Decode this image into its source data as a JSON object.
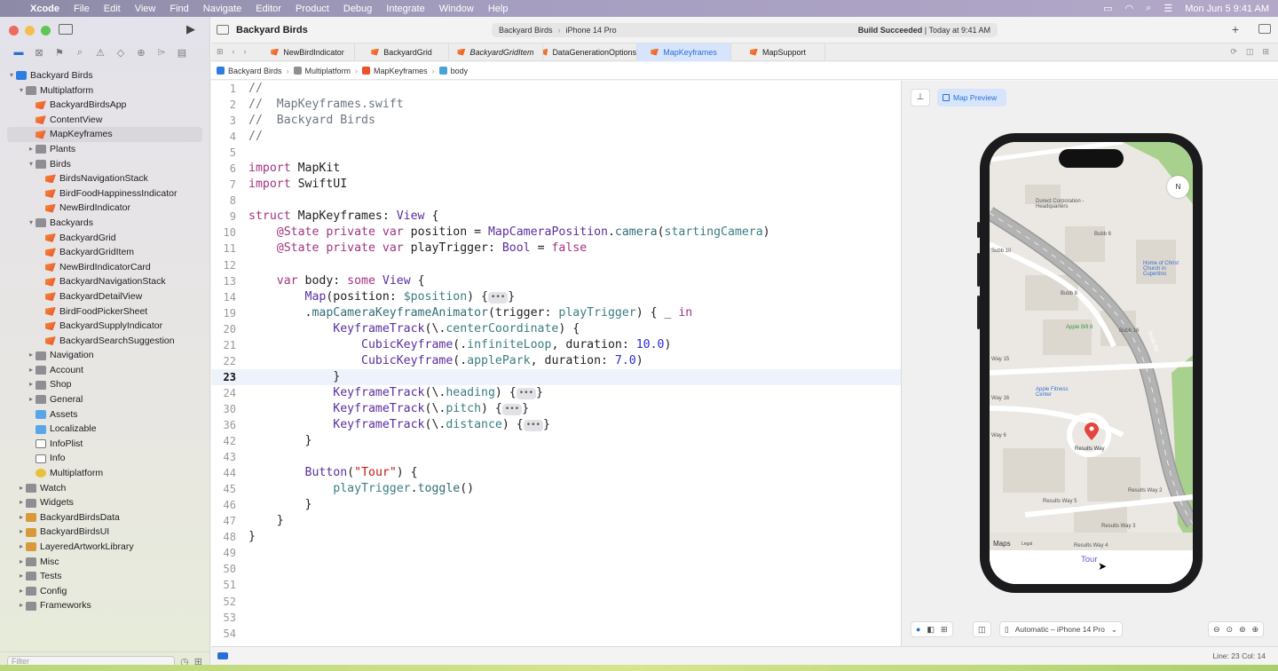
{
  "menubar": {
    "items": [
      "Xcode",
      "File",
      "Edit",
      "View",
      "Find",
      "Navigate",
      "Editor",
      "Product",
      "Debug",
      "Integrate",
      "Window",
      "Help"
    ],
    "clock": "Mon Jun 5  9:41 AM"
  },
  "toolbar": {
    "project": "Backyard Birds",
    "scheme": "Backyard Birds",
    "destination": "iPhone 14 Pro",
    "status_strong": "Build Succeeded",
    "status_time": "Today at 9:41 AM"
  },
  "tabs": [
    {
      "label": "NewBirdIndicator"
    },
    {
      "label": "BackyardGrid"
    },
    {
      "label": "BackyardGridItem"
    },
    {
      "label": "DataGenerationOptions"
    },
    {
      "label": "MapKeyframes"
    },
    {
      "label": "MapSupport"
    }
  ],
  "jumpbar": [
    "Backyard Birds",
    "Multiplatform",
    "MapKeyframes",
    "body"
  ],
  "navigator": {
    "filter_placeholder": "Filter",
    "items": [
      {
        "label": "Backyard Birds",
        "depth": 0,
        "chev": "▾",
        "icon": "proj"
      },
      {
        "label": "Multiplatform",
        "depth": 1,
        "chev": "▾",
        "icon": "folder"
      },
      {
        "label": "BackyardBirdsApp",
        "depth": 2,
        "chev": "",
        "icon": "swift"
      },
      {
        "label": "ContentView",
        "depth": 2,
        "chev": "",
        "icon": "swift"
      },
      {
        "label": "MapKeyframes",
        "depth": 2,
        "chev": "",
        "icon": "swift",
        "selected": true
      },
      {
        "label": "Plants",
        "depth": 2,
        "chev": "▸",
        "icon": "folder"
      },
      {
        "label": "Birds",
        "depth": 2,
        "chev": "▾",
        "icon": "folder"
      },
      {
        "label": "BirdsNavigationStack",
        "depth": 3,
        "chev": "",
        "icon": "swift"
      },
      {
        "label": "BirdFoodHappinessIndicator",
        "depth": 3,
        "chev": "",
        "icon": "swift"
      },
      {
        "label": "NewBirdIndicator",
        "depth": 3,
        "chev": "",
        "icon": "swift"
      },
      {
        "label": "Backyards",
        "depth": 2,
        "chev": "▾",
        "icon": "folder"
      },
      {
        "label": "BackyardGrid",
        "depth": 3,
        "chev": "",
        "icon": "swift"
      },
      {
        "label": "BackyardGridItem",
        "depth": 3,
        "chev": "",
        "icon": "swift"
      },
      {
        "label": "NewBirdIndicatorCard",
        "depth": 3,
        "chev": "",
        "icon": "swift"
      },
      {
        "label": "BackyardNavigationStack",
        "depth": 3,
        "chev": "",
        "icon": "swift"
      },
      {
        "label": "BackyardDetailView",
        "depth": 3,
        "chev": "",
        "icon": "swift"
      },
      {
        "label": "BirdFoodPickerSheet",
        "depth": 3,
        "chev": "",
        "icon": "swift"
      },
      {
        "label": "BackyardSupplyIndicator",
        "depth": 3,
        "chev": "",
        "icon": "swift"
      },
      {
        "label": "BackyardSearchSuggestion",
        "depth": 3,
        "chev": "",
        "icon": "swift"
      },
      {
        "label": "Navigation",
        "depth": 2,
        "chev": "▸",
        "icon": "folder"
      },
      {
        "label": "Account",
        "depth": 2,
        "chev": "▸",
        "icon": "folder"
      },
      {
        "label": "Shop",
        "depth": 2,
        "chev": "▸",
        "icon": "folder"
      },
      {
        "label": "General",
        "depth": 2,
        "chev": "▸",
        "icon": "folder"
      },
      {
        "label": "Assets",
        "depth": 2,
        "chev": "",
        "icon": "asset"
      },
      {
        "label": "Localizable",
        "depth": 2,
        "chev": "",
        "icon": "asset"
      },
      {
        "label": "InfoPlist",
        "depth": 2,
        "chev": "",
        "icon": "plist"
      },
      {
        "label": "Info",
        "depth": 2,
        "chev": "",
        "icon": "info"
      },
      {
        "label": "Multiplatform",
        "depth": 2,
        "chev": "",
        "icon": "ent"
      },
      {
        "label": "Watch",
        "depth": 1,
        "chev": "▸",
        "icon": "folder"
      },
      {
        "label": "Widgets",
        "depth": 1,
        "chev": "▸",
        "icon": "folder"
      },
      {
        "label": "BackyardBirdsData",
        "depth": 1,
        "chev": "▸",
        "icon": "pkg"
      },
      {
        "label": "BackyardBirdsUI",
        "depth": 1,
        "chev": "▸",
        "icon": "pkg"
      },
      {
        "label": "LayeredArtworkLibrary",
        "depth": 1,
        "chev": "▸",
        "icon": "pkg"
      },
      {
        "label": "Misc",
        "depth": 1,
        "chev": "▸",
        "icon": "folder"
      },
      {
        "label": "Tests",
        "depth": 1,
        "chev": "▸",
        "icon": "folder"
      },
      {
        "label": "Config",
        "depth": 1,
        "chev": "▸",
        "icon": "folder"
      },
      {
        "label": "Frameworks",
        "depth": 1,
        "chev": "▸",
        "icon": "folder"
      }
    ]
  },
  "code": {
    "current_line": "23",
    "lines": [
      {
        "n": "1",
        "t": [
          [
            "c-cm",
            "//"
          ]
        ]
      },
      {
        "n": "2",
        "t": [
          [
            "c-cm",
            "//  MapKeyframes.swift"
          ]
        ]
      },
      {
        "n": "3",
        "t": [
          [
            "c-cm",
            "//  Backyard Birds"
          ]
        ]
      },
      {
        "n": "4",
        "t": [
          [
            "c-cm",
            "//"
          ]
        ]
      },
      {
        "n": "5",
        "t": []
      },
      {
        "n": "6",
        "t": [
          [
            "c-kw",
            "import"
          ],
          [
            "",
            " MapKit"
          ]
        ]
      },
      {
        "n": "7",
        "t": [
          [
            "c-kw",
            "import"
          ],
          [
            "",
            " SwiftUI"
          ]
        ]
      },
      {
        "n": "8",
        "t": []
      },
      {
        "n": "9",
        "t": [
          [
            "c-kw",
            "struct"
          ],
          [
            "",
            " MapKeyframes: "
          ],
          [
            "c-ty",
            "View"
          ],
          [
            "",
            " {"
          ]
        ]
      },
      {
        "n": "10",
        "t": [
          [
            "",
            "    "
          ],
          [
            "c-kw",
            "@State"
          ],
          [
            "",
            " "
          ],
          [
            "c-kw",
            "private var"
          ],
          [
            "",
            " position = "
          ],
          [
            "c-ty",
            "MapCameraPosition"
          ],
          [
            "",
            "."
          ],
          [
            "c-fn",
            "camera"
          ],
          [
            "",
            "("
          ],
          [
            "c-pr",
            "startingCamera"
          ],
          [
            "",
            ")"
          ]
        ]
      },
      {
        "n": "11",
        "t": [
          [
            "",
            "    "
          ],
          [
            "c-kw",
            "@State"
          ],
          [
            "",
            " "
          ],
          [
            "c-kw",
            "private var"
          ],
          [
            "",
            " playTrigger: "
          ],
          [
            "c-ty",
            "Bool"
          ],
          [
            "",
            " = "
          ],
          [
            "c-kw",
            "false"
          ]
        ]
      },
      {
        "n": "12",
        "t": []
      },
      {
        "n": "13",
        "t": [
          [
            "",
            "    "
          ],
          [
            "c-kw",
            "var"
          ],
          [
            "",
            " body: "
          ],
          [
            "c-kw",
            "some"
          ],
          [
            "",
            " "
          ],
          [
            "c-ty",
            "View"
          ],
          [
            "",
            " {"
          ]
        ]
      },
      {
        "n": "14",
        "t": [
          [
            "",
            "        "
          ],
          [
            "c-ty",
            "Map"
          ],
          [
            "",
            "(position: "
          ],
          [
            "c-pr",
            "$position"
          ],
          [
            "",
            ") {"
          ],
          [
            "fold",
            "•••"
          ],
          [
            "",
            "}"
          ]
        ]
      },
      {
        "n": "19",
        "t": [
          [
            "",
            "        ."
          ],
          [
            "c-fn",
            "mapCameraKeyframeAnimator"
          ],
          [
            "",
            "(trigger: "
          ],
          [
            "c-pr",
            "playTrigger"
          ],
          [
            "",
            ") { _ "
          ],
          [
            "c-kw",
            "in"
          ]
        ]
      },
      {
        "n": "20",
        "t": [
          [
            "",
            "            "
          ],
          [
            "c-ty",
            "KeyframeTrack"
          ],
          [
            "",
            "(\\."
          ],
          [
            "c-pr",
            "centerCoordinate"
          ],
          [
            "",
            ") {"
          ]
        ]
      },
      {
        "n": "21",
        "t": [
          [
            "",
            "                "
          ],
          [
            "c-ty",
            "CubicKeyframe"
          ],
          [
            "",
            "(."
          ],
          [
            "c-pr",
            "infiniteLoop"
          ],
          [
            "",
            ", duration: "
          ],
          [
            "c-nu",
            "10.0"
          ],
          [
            "",
            ")"
          ]
        ]
      },
      {
        "n": "22",
        "t": [
          [
            "",
            "                "
          ],
          [
            "c-ty",
            "CubicKeyframe"
          ],
          [
            "",
            "(."
          ],
          [
            "c-pr",
            "applePark"
          ],
          [
            "",
            ", duration: "
          ],
          [
            "c-nu",
            "7.0"
          ],
          [
            "",
            ")"
          ]
        ]
      },
      {
        "n": "23",
        "t": [
          [
            "",
            "            }"
          ]
        ]
      },
      {
        "n": "24",
        "t": [
          [
            "",
            "            "
          ],
          [
            "c-ty",
            "KeyframeTrack"
          ],
          [
            "",
            "(\\."
          ],
          [
            "c-pr",
            "heading"
          ],
          [
            "",
            ") {"
          ],
          [
            "fold",
            "•••"
          ],
          [
            "",
            "}"
          ]
        ]
      },
      {
        "n": "30",
        "t": [
          [
            "",
            "            "
          ],
          [
            "c-ty",
            "KeyframeTrack"
          ],
          [
            "",
            "(\\."
          ],
          [
            "c-pr",
            "pitch"
          ],
          [
            "",
            ") {"
          ],
          [
            "fold",
            "•••"
          ],
          [
            "",
            "}"
          ]
        ]
      },
      {
        "n": "36",
        "t": [
          [
            "",
            "            "
          ],
          [
            "c-ty",
            "KeyframeTrack"
          ],
          [
            "",
            "(\\."
          ],
          [
            "c-pr",
            "distance"
          ],
          [
            "",
            ") {"
          ],
          [
            "fold",
            "•••"
          ],
          [
            "",
            "}"
          ]
        ]
      },
      {
        "n": "42",
        "t": [
          [
            "",
            "        }"
          ]
        ]
      },
      {
        "n": "43",
        "t": []
      },
      {
        "n": "44",
        "t": [
          [
            "",
            "        "
          ],
          [
            "c-ty",
            "Button"
          ],
          [
            "",
            "("
          ],
          [
            "c-st",
            "\"Tour\""
          ],
          [
            "",
            ") {"
          ]
        ]
      },
      {
        "n": "45",
        "t": [
          [
            "",
            "            "
          ],
          [
            "c-pr",
            "playTrigger"
          ],
          [
            "",
            "."
          ],
          [
            "c-fn",
            "toggle"
          ],
          [
            "",
            "()"
          ]
        ]
      },
      {
        "n": "46",
        "t": [
          [
            "",
            "        }"
          ]
        ]
      },
      {
        "n": "47",
        "t": [
          [
            "",
            "    }"
          ]
        ]
      },
      {
        "n": "48",
        "t": [
          [
            "",
            "}"
          ]
        ]
      },
      {
        "n": "49",
        "t": []
      },
      {
        "n": "50",
        "t": []
      },
      {
        "n": "51",
        "t": []
      },
      {
        "n": "52",
        "t": []
      },
      {
        "n": "53",
        "t": []
      },
      {
        "n": "54",
        "t": []
      }
    ]
  },
  "preview": {
    "tab_label": "Map Preview",
    "device_label": "Automatic – iPhone 14 Pro",
    "tour_button": "Tour",
    "compass": "N",
    "maps_logo": "Maps",
    "legal": "Legal",
    "map_labels": [
      "Durect Corporation - Headquarters",
      "Bubb 6",
      "Home of Christ Church in Cupertino",
      "Bubb 8",
      "Apple Bifi 8",
      "Bubb 16",
      "Apple Fitness Center",
      "Results Way",
      "Results Way 2",
      "Results Way 5",
      "Results Way 3",
      "Results Way 4",
      "Bubb Rd",
      "Subb 10",
      "Way 15",
      "Way 16",
      "Way 6"
    ]
  },
  "statusbar": {
    "position": "Line: 23  Col: 14"
  }
}
